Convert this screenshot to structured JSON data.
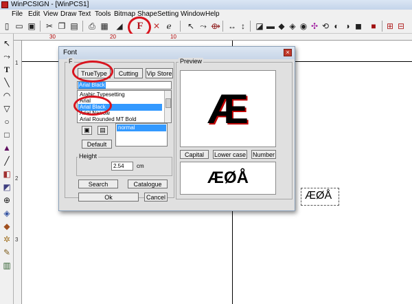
{
  "window": {
    "title": "WinPCSIGN - [WinPCS1]"
  },
  "menu": [
    "File",
    "Edit",
    "View",
    "Draw",
    "Text",
    "Tools",
    "Bitmap",
    "Shape",
    "Setting",
    "Window",
    "Help"
  ],
  "ruler": {
    "h": [
      "30",
      "20",
      "10"
    ],
    "v": [
      "1",
      "2",
      "3"
    ]
  },
  "toolbar": {
    "font_button_label": "F"
  },
  "canvas": {
    "sample_text": "ÆØÅ"
  },
  "dialog": {
    "title": "Font",
    "close_label": "×",
    "font_group_label": "F",
    "tabs": {
      "truetype": "TrueType",
      "cutting": "Cutting",
      "vipstore": "Vip Store"
    },
    "selected_font_field": "Arial Black",
    "font_list": [
      "Arabic Typesetting",
      "Arial",
      "Arial Black",
      "Arial Narrow",
      "Arial Rounded MT Bold"
    ],
    "selected_index": 2,
    "style_list": [
      "normal"
    ],
    "default_label": "Default",
    "height_label": "Height",
    "height_value": "2.54",
    "height_unit": "cm",
    "search_label": "Search",
    "catalogue_label": "Catalogue",
    "ok_label": "Ok",
    "cancel_label": "Cancel",
    "preview_label": "Preview",
    "preview_glyph": "Æ",
    "case_buttons": {
      "capital": "Capital",
      "lowercase": "Lower case",
      "number": "Number"
    },
    "sample_text": "ÆØÅ"
  },
  "colors": {
    "annotation_red": "#d8141e",
    "selection_blue": "#3399ff",
    "font_icon_red": "#b0101a"
  }
}
